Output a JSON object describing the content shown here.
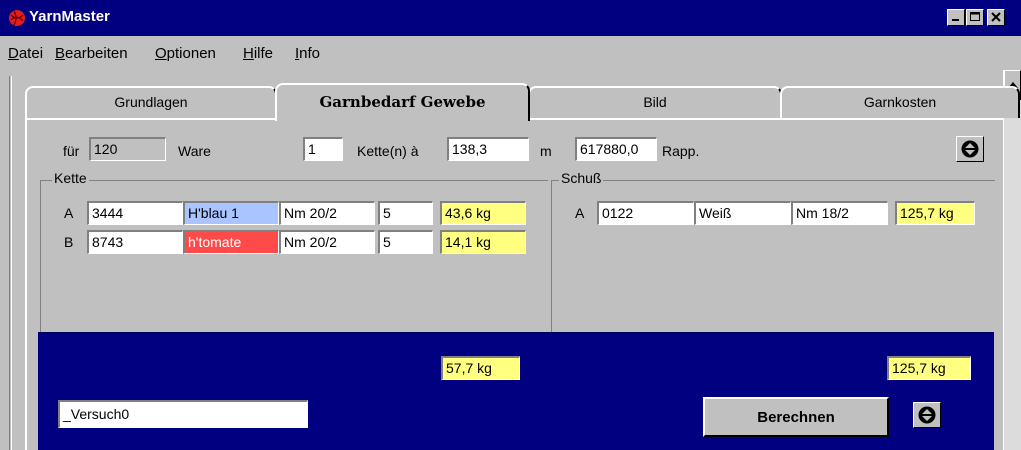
{
  "window": {
    "title": "YarnMaster"
  },
  "menu": [
    {
      "label": "Datei",
      "underline": "D",
      "rest": "atei"
    },
    {
      "label": "Bearbeiten",
      "underline": "B",
      "rest": "earbeiten"
    },
    {
      "label": "Optionen",
      "underline": "O",
      "rest": "ptionen"
    },
    {
      "label": "Hilfe",
      "underline": "H",
      "rest": "ilfe"
    },
    {
      "label": "Info",
      "underline": "I",
      "rest": "nfo"
    }
  ],
  "tabs": [
    "Grundlagen",
    "Garnbedarf Gewebe",
    "Bild",
    "Garnkosten"
  ],
  "active_tab": 1,
  "header": {
    "fuer_label": "für",
    "fuer_value": "120",
    "ware_label": "Ware",
    "kette_count": "1",
    "kette_label": "Kette(n) à",
    "kette_length": "138,3",
    "m_label": "m",
    "rapp_value": "617880,0",
    "rapp_label": "Rapp."
  },
  "kette": {
    "title": "Kette",
    "rows": [
      {
        "letter": "A",
        "number": "3444",
        "color": "H'blau 1",
        "nm": "Nm 20/2",
        "count": "5",
        "weight": "43,6 kg"
      },
      {
        "letter": "B",
        "number": "8743",
        "color": "h'tomate",
        "nm": "Nm 20/2",
        "count": "5",
        "weight": "14,1 kg"
      }
    ],
    "total": "57,7 kg"
  },
  "schuss": {
    "title": "Schuß",
    "rows": [
      {
        "letter": "A",
        "number": "0122",
        "color": "Weiß",
        "nm": "Nm 18/2",
        "weight": "125,7 kg"
      }
    ],
    "total": "125,7 kg"
  },
  "bottom": {
    "version_value": "_Versuch0",
    "calc_button": "Berechnen"
  },
  "colors": {
    "titlebar": "#000080",
    "panel": "#c0c0c0",
    "highlight_yellow": "#ffff80",
    "swatch_blue": "#aac4ff",
    "swatch_red": "#ff4a4a"
  }
}
